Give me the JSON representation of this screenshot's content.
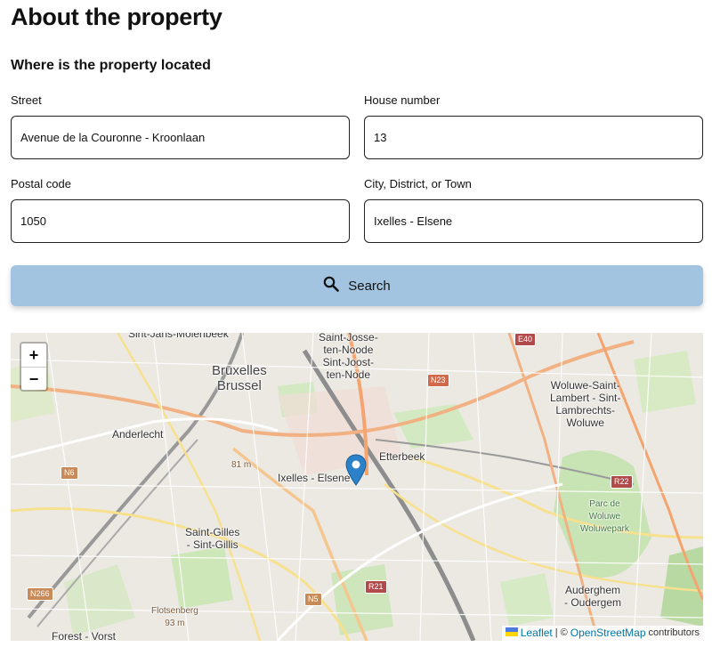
{
  "page": {
    "title": "About the property"
  },
  "location": {
    "heading": "Where is the property located"
  },
  "form": {
    "street": {
      "label": "Street",
      "value": "Avenue de la Couronne - Kroonlaan"
    },
    "house_number": {
      "label": "House number",
      "value": "13"
    },
    "postal_code": {
      "label": "Postal code",
      "value": "1050"
    },
    "city": {
      "label": "City, District, or Town",
      "value": "Ixelles - Elsene"
    }
  },
  "search_button": {
    "label": "Search",
    "icon": "search-icon",
    "color": "#a3c4e0"
  },
  "map": {
    "zoom_in": "+",
    "zoom_out": "−",
    "marker_color": "#2b82cb",
    "labels": {
      "molenbeek": "Sint-Jans-Molenbeek",
      "bruxelles": "Bruxelles\nBrussel",
      "saint_josse": "Saint-Josse-\nten-Noode\nSint-Joost-\nten-Node",
      "woluwe_lambert": "Woluwe-Saint-\nLambert - Sint-\nLambrechts-\nWoluwe",
      "anderlecht": "Anderlecht",
      "etterbeek": "Etterbeek",
      "ixelles": "Ixelles - Elsene",
      "saint_gilles": "Saint-Gilles\n- Sint-Gillis",
      "auderghem": "Auderghem\n- Oudergem",
      "forest": "Forest - Vorst",
      "parc_woluwe": "Parc de\nWoluwe\nWoluwepark",
      "elev_81": "81 m",
      "flotsenberg": "Flotsenberg\n93 m"
    },
    "roads": {
      "e40": "E40",
      "n23": "N23",
      "n6": "N6",
      "r22": "R22",
      "n5": "N5",
      "r21": "R21",
      "n266": "N266"
    },
    "attribution": {
      "leaflet": "Leaflet",
      "separator": "| ©",
      "osm": "OpenStreetMap",
      "suffix": "contributors"
    }
  }
}
